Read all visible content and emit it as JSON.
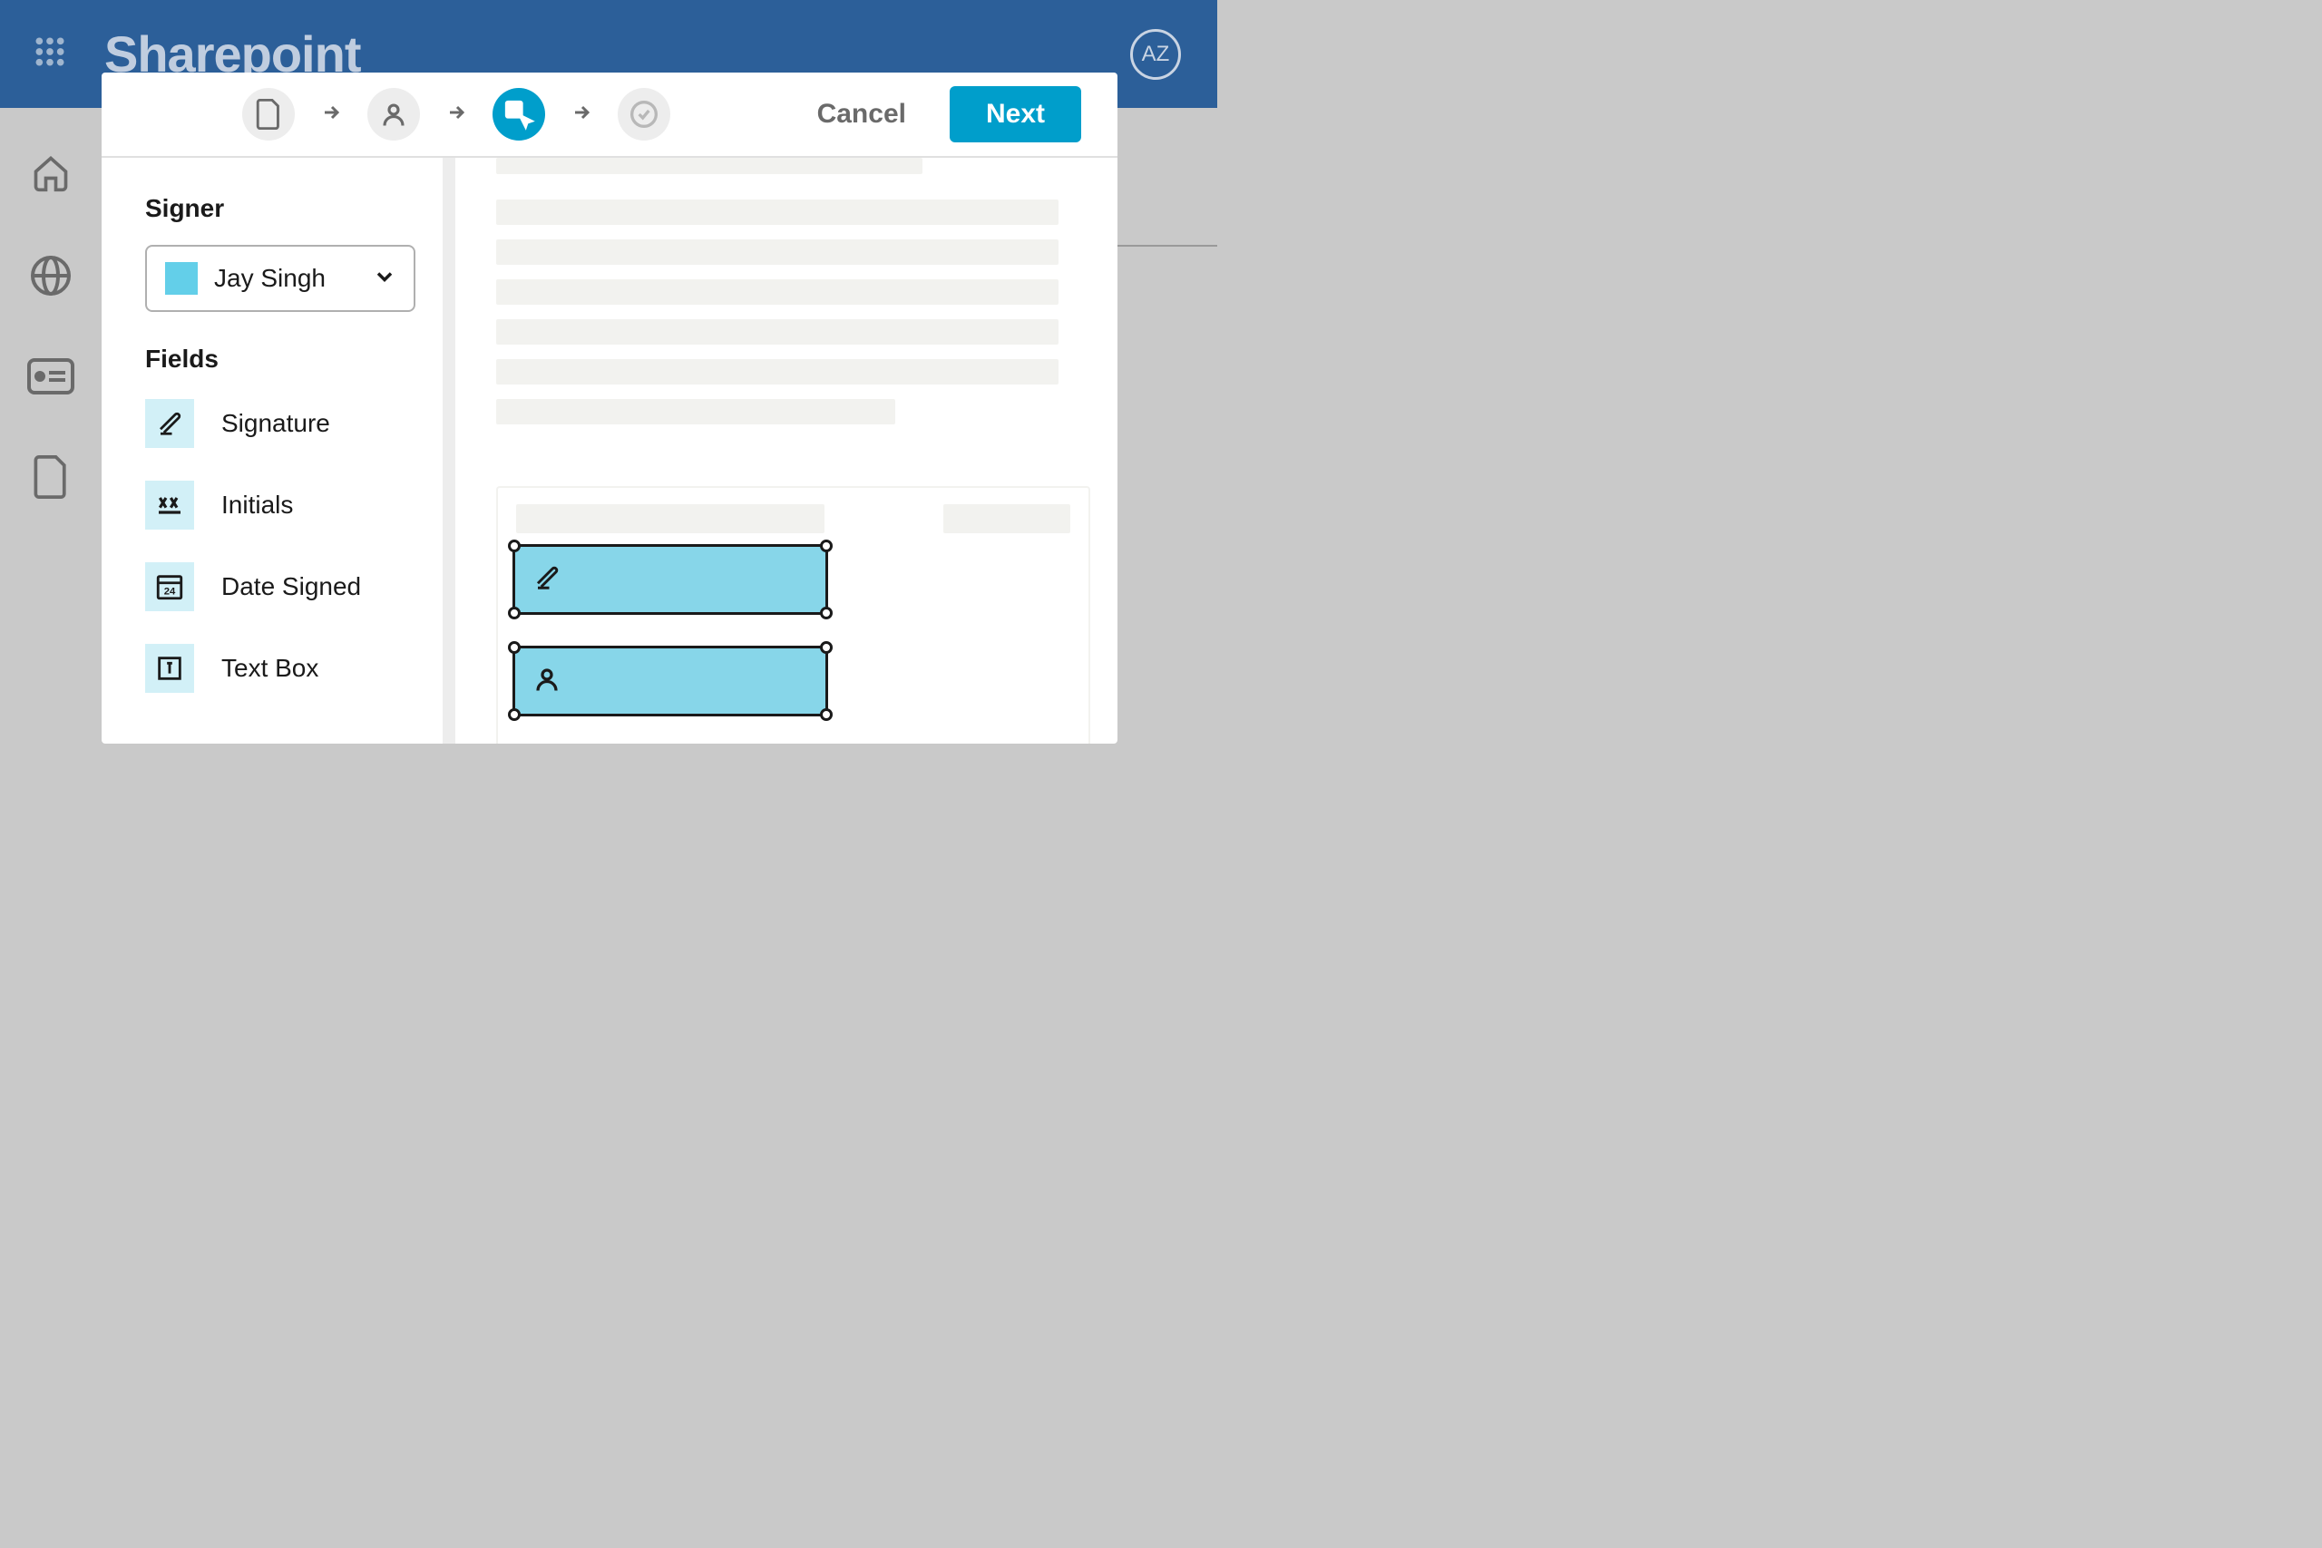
{
  "header": {
    "title": "Sharepoint",
    "avatar_initials": "AZ"
  },
  "modal": {
    "cancel_label": "Cancel",
    "next_label": "Next",
    "steps": [
      "document",
      "person",
      "place-fields",
      "review"
    ],
    "active_step_index": 2
  },
  "panel": {
    "signer_label": "Signer",
    "signer_selected": "Jay Singh",
    "fields_label": "Fields",
    "fields": [
      {
        "id": "signature",
        "label": "Signature"
      },
      {
        "id": "initials",
        "label": "Initials"
      },
      {
        "id": "date-signed",
        "label": "Date Signed"
      },
      {
        "id": "text-box",
        "label": "Text Box"
      }
    ]
  },
  "colors": {
    "brand_blue": "#2c5f99",
    "accent_cyan": "#009ecb",
    "field_bg": "#87d6e9",
    "field_icon_bg": "#d2f0f7"
  }
}
